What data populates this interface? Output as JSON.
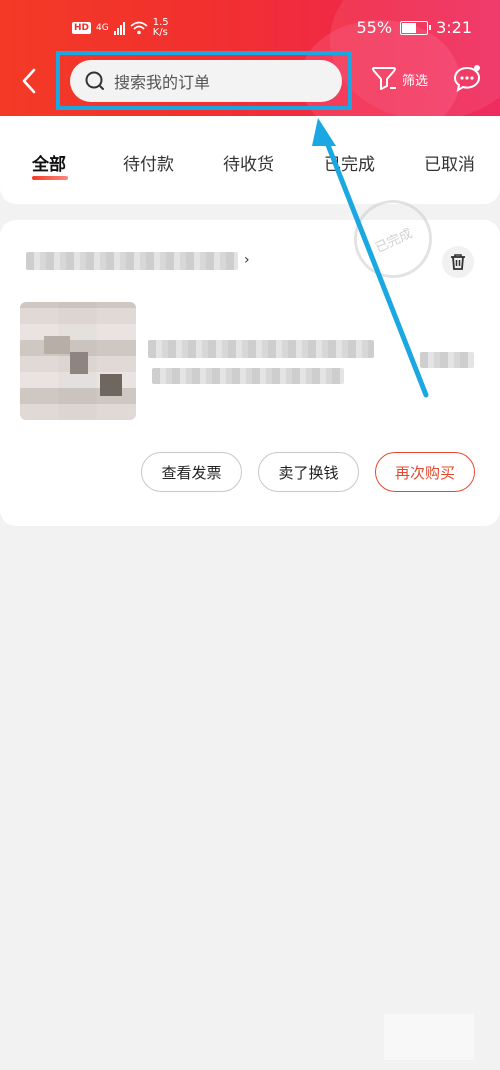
{
  "status_bar": {
    "network_badge": "HD",
    "network_type": "4G",
    "speed_value": "1.5",
    "speed_unit": "K/s",
    "battery": "55%",
    "time": "3:21"
  },
  "header": {
    "search_placeholder": "搜索我的订单",
    "filter_label": "筛选"
  },
  "tabs": [
    {
      "label": "全部",
      "active": true
    },
    {
      "label": "待付款",
      "active": false
    },
    {
      "label": "待收货",
      "active": false
    },
    {
      "label": "已完成",
      "active": false
    },
    {
      "label": "已取消",
      "active": false
    }
  ],
  "order": {
    "shop_arrow": "›",
    "stamp": "已完成",
    "actions": {
      "invoice": "查看发票",
      "sell": "卖了换钱",
      "rebuy": "再次购买"
    }
  },
  "colors": {
    "accent_red": "#f2302e",
    "rebuy_border": "#e5492f",
    "highlight_blue": "#1aa7e2"
  }
}
